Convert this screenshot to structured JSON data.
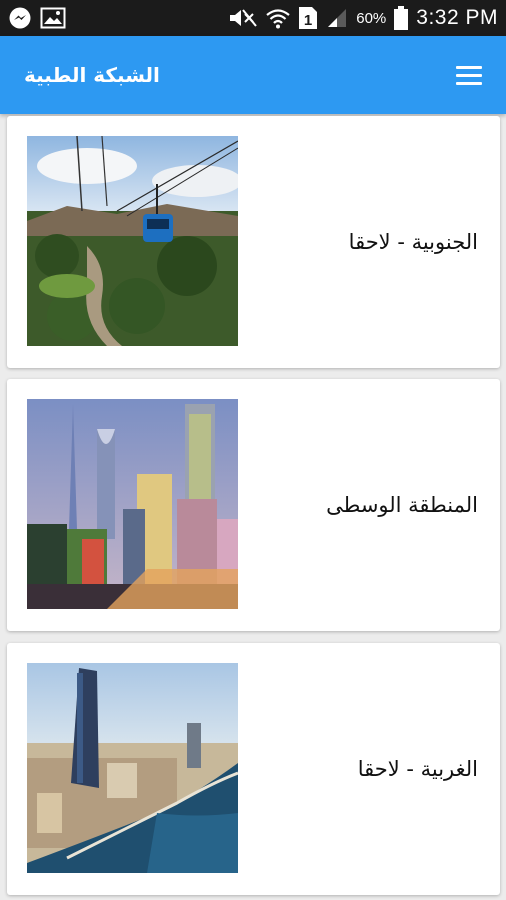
{
  "status_bar": {
    "battery_percent": "60%",
    "time": "3:32 PM",
    "sim_slot": "1"
  },
  "app_bar": {
    "title": "الشبكة الطبية",
    "menu_icon": "hamburger-menu-icon"
  },
  "regions": [
    {
      "label": "الجنوبية - لاحقا",
      "image": "cable-car-photo"
    },
    {
      "label": "المنطقة الوسطى",
      "image": "city-skyline-photo"
    },
    {
      "label": "الغربية - لاحقا",
      "image": "coastal-city-photo"
    }
  ],
  "colors": {
    "status_bar": "#1b1b1b",
    "app_bar": "#2d99f2",
    "background": "#ececec",
    "card": "#ffffff"
  }
}
